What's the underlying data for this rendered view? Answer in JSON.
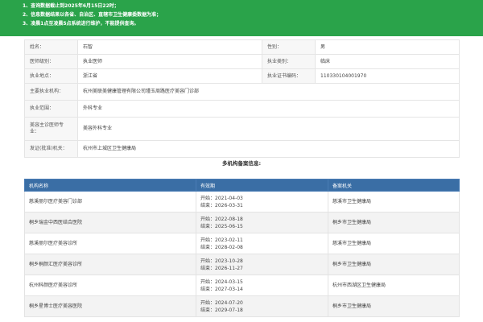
{
  "banner": {
    "lines": [
      "1、查询数据截止到2025年6月15日22时；",
      "2、信息数据结果以各省、自治区、直辖市卫生健康委数据为准；",
      "3、凌晨1点至凌晨5点系统进行维护，不能提供查询。"
    ]
  },
  "info": {
    "name_label": "姓名：",
    "name": "石智",
    "gender_label": "性别：",
    "gender": "男",
    "level_label": "医师级别：",
    "level": "执业医师",
    "category_label": "执业类别：",
    "category": "临床",
    "place_label": "执业地点：",
    "place": "浙江省",
    "cert_label": "执业证书编码：",
    "cert": "110330104001970",
    "org_label": "主要执业机构：",
    "org": "杭州美联美健康管理有限公司瑾玉周路医疗美容门诊部",
    "scope_label": "执业范围：",
    "scope": "外科专业",
    "major_label": "美容主诊医师专业：",
    "major": "美容外科专业",
    "issuer_label": "发证(批准)机关：",
    "issuer": "杭州市上城区卫生健康局"
  },
  "section_title": "多机构备案信息:",
  "table": {
    "headers": [
      "机构名称",
      "有效期",
      "备案机关"
    ],
    "rows": [
      {
        "name": "慈溪丽尔医疗美容门诊部",
        "start": "开始：2021-04-03",
        "end": "结束：2026-03-31",
        "authority": "慈溪市卫生健康局"
      },
      {
        "name": "桐乡瑞金中西医结合医院",
        "start": "开始：2022-08-18",
        "end": "结束：2025-06-15",
        "authority": "桐乡市卫生健康局"
      },
      {
        "name": "慈溪丽尔医疗美容诊所",
        "start": "开始：2023-02-11",
        "end": "结束：2028-02-08",
        "authority": "慈溪市卫生健康局"
      },
      {
        "name": "桐乡桐颜汇医疗美容诊所",
        "start": "开始：2023-10-28",
        "end": "结束：2026-11-27",
        "authority": "桐乡市卫生健康局"
      },
      {
        "name": "杭州科颜医疗美容诊所",
        "start": "开始：2024-03-15",
        "end": "结束：2027-03-14",
        "authority": "杭州市西湖区卫生健康局"
      },
      {
        "name": "桐乡星博士医疗美容医院",
        "start": "开始：2024-07-20",
        "end": "结束：2029-07-18",
        "authority": "桐乡市卫生健康局"
      }
    ]
  },
  "colors": {
    "banner": "#2aa34a",
    "table_header": "#3a6ea5"
  }
}
